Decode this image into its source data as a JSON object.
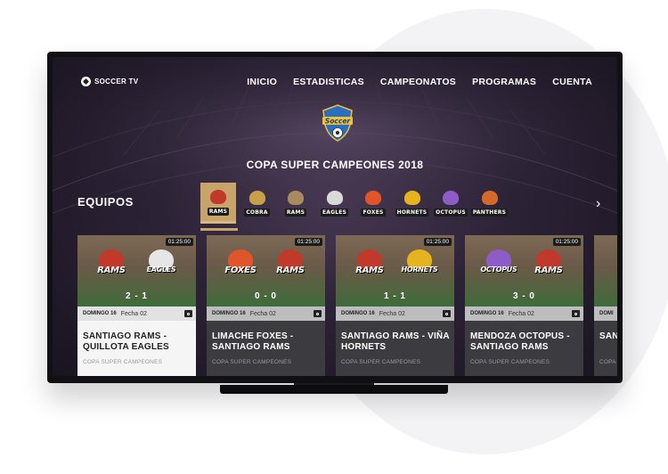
{
  "brand": {
    "name": "SOCCER TV"
  },
  "nav": [
    {
      "label": "INICIO"
    },
    {
      "label": "ESTADISTICAS"
    },
    {
      "label": "CAMPEONATOS"
    },
    {
      "label": "PROGRAMAS"
    },
    {
      "label": "CUENTA"
    }
  ],
  "tournament": {
    "logo_word": "Soccer",
    "title": "COPA SUPER CAMPEONES 2018"
  },
  "teams": {
    "label": "EQUIPOS",
    "items": [
      {
        "name": "RAMS",
        "color": "#c0392b",
        "active": true
      },
      {
        "name": "COBRA",
        "color": "#c8a04a"
      },
      {
        "name": "RAMS",
        "color": "#a98a5e"
      },
      {
        "name": "EAGLES",
        "color": "#d9d9d9"
      },
      {
        "name": "FOXES",
        "color": "#e0552a"
      },
      {
        "name": "HORNETS",
        "color": "#e5b31d"
      },
      {
        "name": "OCTOPUS",
        "color": "#8e5cc7"
      },
      {
        "name": "PANTHERS",
        "color": "#d46a2a"
      }
    ],
    "next_icon": "chevron-right-icon"
  },
  "matches": [
    {
      "duration": "01:25:00",
      "home": {
        "name": "RAMS",
        "color": "#c0392b"
      },
      "away": {
        "name": "EAGLES",
        "color": "#e6e6e6"
      },
      "score": "2 - 1",
      "date": "DOMINGO 16",
      "fecha": "Fecha 02",
      "title": "SANTIAGO RAMS - QUILLOTA EAGLES",
      "competition": "COPA SUPER CAMPEONES",
      "active": true
    },
    {
      "duration": "01:25:00",
      "home": {
        "name": "FOXES",
        "color": "#e0552a"
      },
      "away": {
        "name": "RAMS",
        "color": "#c0392b"
      },
      "score": "0 - 0",
      "date": "DOMINGO 16",
      "fecha": "Fecha 02",
      "title": "LIMACHE FOXES - SANTIAGO RAMS",
      "competition": "COPA SUPER CAMPEONES"
    },
    {
      "duration": "01:25:00",
      "home": {
        "name": "RAMS",
        "color": "#c0392b"
      },
      "away": {
        "name": "HORNETS",
        "color": "#e5b31d"
      },
      "score": "1 - 1",
      "date": "DOMINGO 16",
      "fecha": "Fecha 02",
      "title": "SANTIAGO RAMS - VIÑA HORNETS",
      "competition": "COPA SUPER CAMPEONES"
    },
    {
      "duration": "01:25:00",
      "home": {
        "name": "OCTOPUS",
        "color": "#8e5cc7"
      },
      "away": {
        "name": "RAMS",
        "color": "#c0392b"
      },
      "score": "3 - 0",
      "date": "DOMINGO 16",
      "fecha": "Fecha 02",
      "title": "MENDOZA OCTOPUS - SANTIAGO RAMS",
      "competition": "COPA SUPER CAMPEONES"
    },
    {
      "partial": true,
      "date": "DOMI",
      "title": "SAN QUIL",
      "competition": "COPA"
    }
  ]
}
